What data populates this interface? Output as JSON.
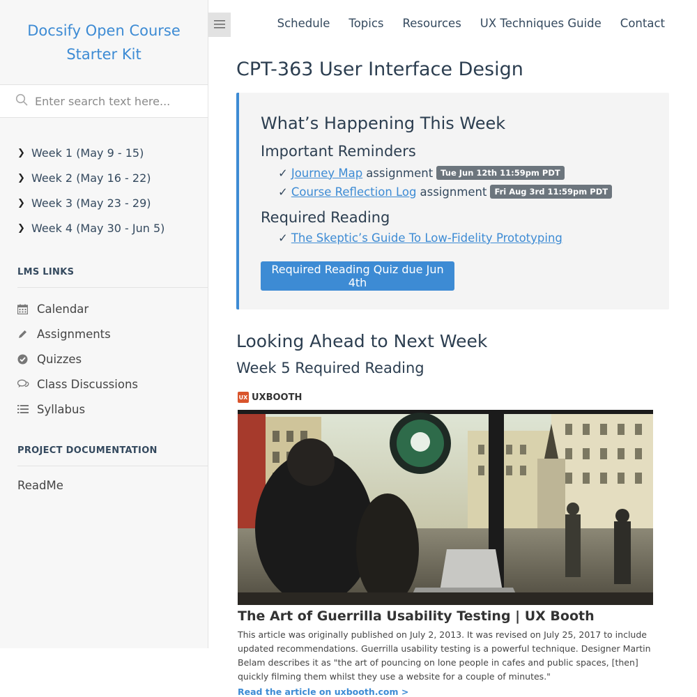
{
  "sidebar": {
    "app_name_line1": "Docsify Open Course",
    "app_name_line2": "Starter Kit",
    "search_placeholder": "Enter search text here...",
    "weeks": [
      {
        "label": "Week 1 (May 9 - 15)"
      },
      {
        "label": "Week 2 (May 16 - 22)"
      },
      {
        "label": "Week 3 (May 23 - 29)"
      },
      {
        "label": "Week 4 (May 30 - Jun 5)"
      }
    ],
    "lms_title": "LMS LINKS",
    "lms_items": [
      {
        "label": "Calendar",
        "icon": "calendar-icon"
      },
      {
        "label": "Assignments",
        "icon": "pencil-icon"
      },
      {
        "label": "Quizzes",
        "icon": "check-circle-icon"
      },
      {
        "label": "Class Discussions",
        "icon": "comments-icon"
      },
      {
        "label": "Syllabus",
        "icon": "list-icon"
      }
    ],
    "project_title": "PROJECT DOCUMENTATION",
    "readme": "ReadMe"
  },
  "nav": {
    "items": [
      "Schedule",
      "Topics",
      "Resources",
      "UX Techniques Guide",
      "Contact"
    ]
  },
  "main": {
    "title": "CPT-363 User Interface Design",
    "callout": {
      "heading": "What’s Happening This Week",
      "reminders_heading": "Important Reminders",
      "reminders": [
        {
          "check": "✓",
          "link": "Journey Map",
          "suffix": "assignment",
          "badge": "Tue Jun 12th 11:59pm PDT"
        },
        {
          "check": "✓",
          "link": "Course Reflection Log",
          "suffix": "assignment",
          "badge": "Fri Aug 3rd 11:59pm PDT"
        }
      ],
      "reading_heading": "Required Reading",
      "reading": {
        "check": "✓",
        "link": "The Skeptic’s Guide To Low-Fidelity Prototyping"
      },
      "button": "Required Reading Quiz due Jun 4th"
    },
    "ahead_heading": "Looking Ahead to Next Week",
    "week5_heading": "Week 5 Required Reading",
    "article": {
      "site": "UXBOOTH",
      "site_logo": "UX",
      "title": "The Art of Guerrilla Usability Testing | UX Booth",
      "description": "This article was originally published on July 2, 2013. It was revised on July 25, 2017 to include updated recommendations. Guerrilla usability testing is a powerful technique. Designer Martin Belam describes it as \"the art of pouncing on lone people in cafes and public spaces, [then] quickly filming them whilst they use a website for a couple of minutes.\"",
      "link": "Read the article on uxbooth.com >"
    }
  },
  "colors": {
    "accent": "#3d8bd4",
    "badge": "#6c757d",
    "sidebar_bg": "#f7f7f7",
    "callout_bg": "#f4f4f4"
  }
}
